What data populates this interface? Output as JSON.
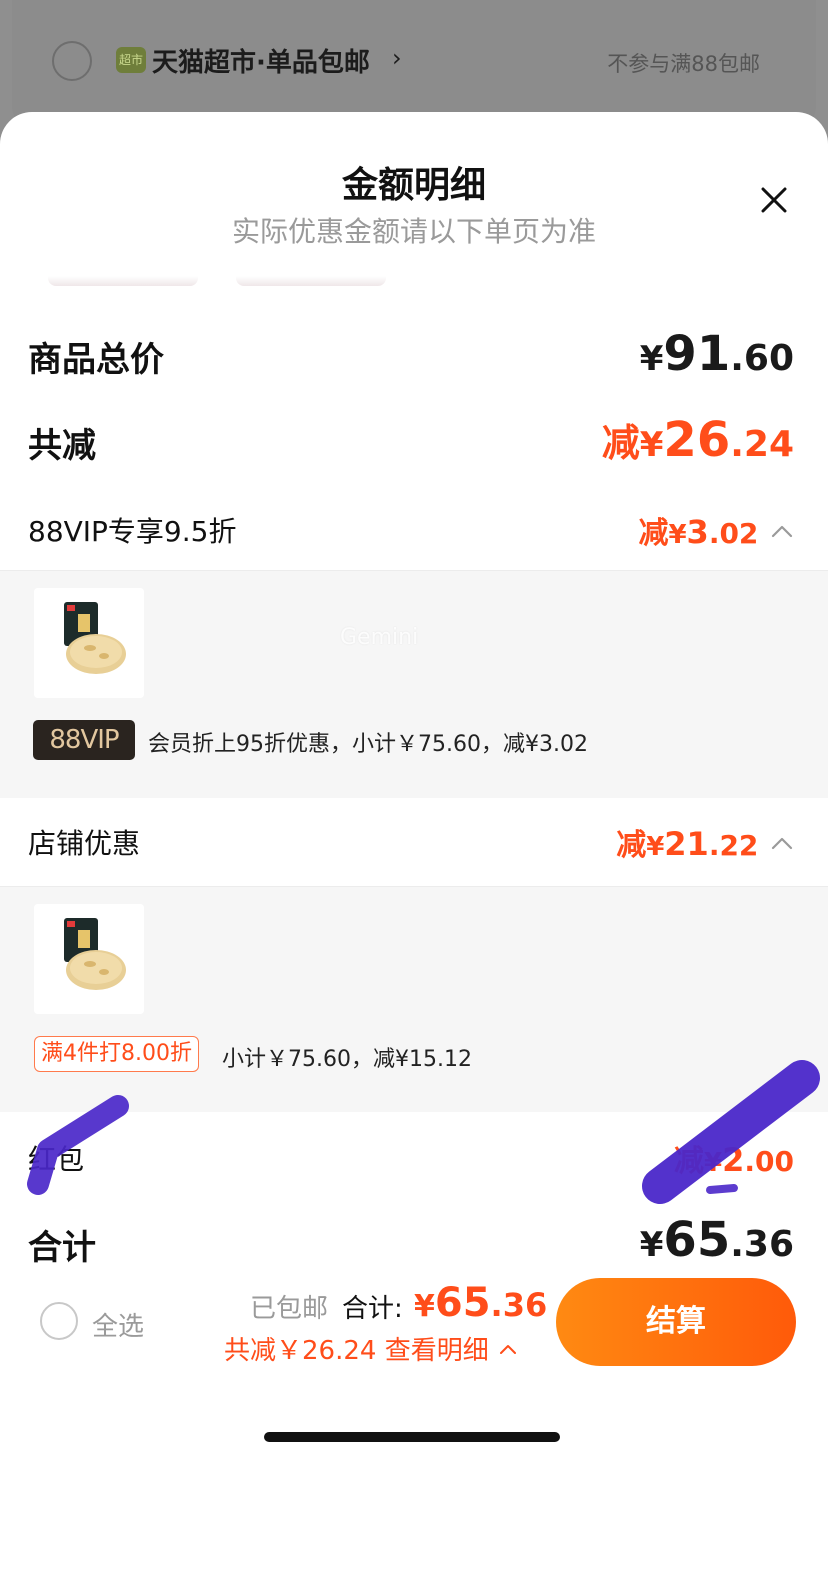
{
  "background_row": {
    "logo_text": "超市",
    "store_name": "天猫超市·单品包邮",
    "note": "不参与满88包邮"
  },
  "sheet": {
    "title": "金额明细",
    "subtitle": "实际优惠金额请以下单页为准"
  },
  "summary": {
    "goods_total_label": "商品总价",
    "goods_total_currency": "¥",
    "goods_total_int": "91",
    "goods_total_dec": ".60",
    "discount_label": "共减",
    "discount_prefix": "减",
    "discount_currency": "¥",
    "discount_int": "26",
    "discount_dec": ".24"
  },
  "vip_section": {
    "label": "88VIP专享9.5折",
    "prefix": "减",
    "currency": "¥",
    "int": "3",
    "dec": ".02",
    "badge": "88VIP",
    "detail": "会员折上95折优惠，小计￥75.60，减¥3.02"
  },
  "store_section": {
    "label": "店铺优惠",
    "prefix": "减",
    "currency": "¥",
    "int": "21",
    "dec": ".22",
    "promo_tag": "满4件打8.00折",
    "detail": "小计￥75.60，减¥15.12"
  },
  "red_packet": {
    "label": "红包",
    "prefix": "减",
    "currency": "¥",
    "int": "2",
    "dec": ".00"
  },
  "total": {
    "label": "合计",
    "currency": "¥",
    "int": "65",
    "dec": ".36"
  },
  "watermark": "Gemini",
  "bottom_bar": {
    "select_all": "全选",
    "shipping": "已包邮",
    "total_label": "合计:",
    "total_currency": "¥",
    "total_int": "65",
    "total_dec": ".36",
    "saved_text": "共减￥26.24 查看明细",
    "checkout_label": "结算"
  },
  "colors": {
    "accent_orange": "#ff4d1a",
    "checkout_gradient_start": "#ff8a12",
    "checkout_gradient_end": "#ff5a0a",
    "vip_badge_bg": "#2a241f",
    "vip_badge_text": "#e2c79f",
    "marker_purple": "#4a27c9"
  }
}
